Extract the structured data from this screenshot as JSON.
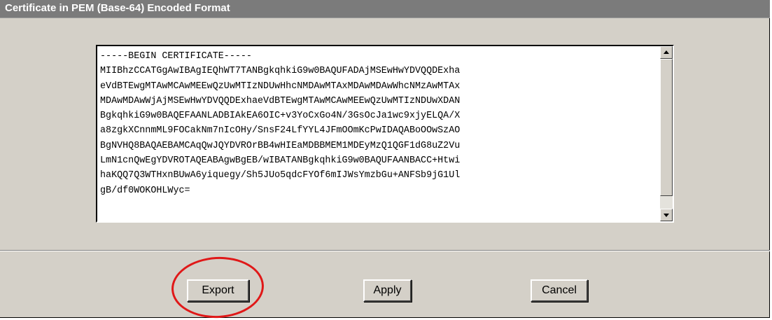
{
  "panel": {
    "title": "Certificate in PEM (Base-64) Encoded Format"
  },
  "certificate": {
    "lines": [
      "-----BEGIN CERTIFICATE-----",
      "MIIBhzCCATGgAwIBAgIEQhWT7TANBgkqhkiG9w0BAQUFADAjMSEwHwYDVQQDExha",
      "eVdBTEwgMTAwMCAwMEEwQzUwMTIzNDUwHhcNMDAwMTAxMDAwMDAwWhcNMzAwMTAx",
      "MDAwMDAwWjAjMSEwHwYDVQQDExhaeVdBTEwgMTAwMCAwMEEwQzUwMTIzNDUwXDAN",
      "BgkqhkiG9w0BAQEFAANLADBIAkEA6OIC+v3YoCxGo4N/3GsOcJa1wc9xjyELQA/X",
      "a8zgkXCnnmML9FOCakNm7nIcOHy/SnsF24LfYYL4JFmOOmKcPwIDAQABoOOwSzAO",
      "BgNVHQ8BAQAEBAMCAqQwJQYDVROrBB4wHIEaMDBBMEM1MDEyMzQ1QGF1dG8uZ2Vu",
      "LmN1cnQwEgYDVROTAQEABAgwBgEB/wIBATANBgkqhkiG9w0BAQUFAANBACC+Htwi",
      "haKQQ7Q3WTHxnBUwA6yiquegy/Sh5JUo5qdcFYOf6mIJWsYmzbGu+ANFSb9jG1Ul",
      "gB/df0WOKOHLWyc="
    ]
  },
  "buttons": {
    "export": "Export",
    "apply": "Apply",
    "cancel": "Cancel"
  },
  "colors": {
    "panel_background": "#d4d0c8",
    "title_bar": "#7b7b7b",
    "highlight": "#e01818"
  }
}
